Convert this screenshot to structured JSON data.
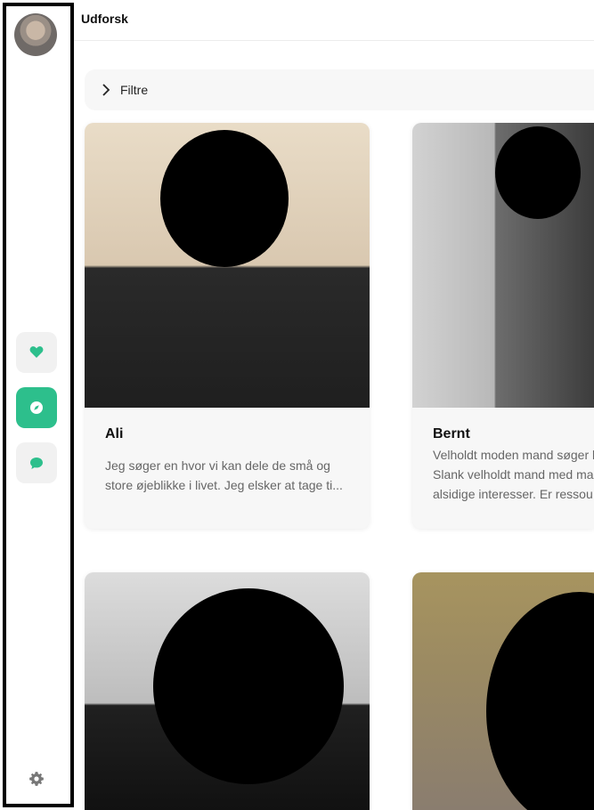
{
  "header": {
    "title": "Udforsk"
  },
  "filter": {
    "label": "Filtre"
  },
  "sidebar": {
    "avatar": "profile-avatar",
    "buttons": [
      {
        "name": "likes",
        "icon": "heart-icon"
      },
      {
        "name": "explore",
        "icon": "compass-icon",
        "active": true
      },
      {
        "name": "chat",
        "icon": "chat-icon"
      }
    ],
    "settings_icon": "gear-icon"
  },
  "colors": {
    "accent": "#2dbf8c",
    "icon_green": "#2dbf8c"
  },
  "cards": [
    {
      "name": "Ali",
      "description": "Jeg søger en hvor vi kan dele de små og\nstore øjeblikke i livet. Jeg elsker at tage ti..."
    },
    {
      "name": "Bernt",
      "description": "Velholdt moden mand søger l\nSlank velholdt mand med ma\nalsidige interesser. Er ressou"
    },
    {
      "name": "",
      "description": ""
    },
    {
      "name": "",
      "description": ""
    }
  ]
}
